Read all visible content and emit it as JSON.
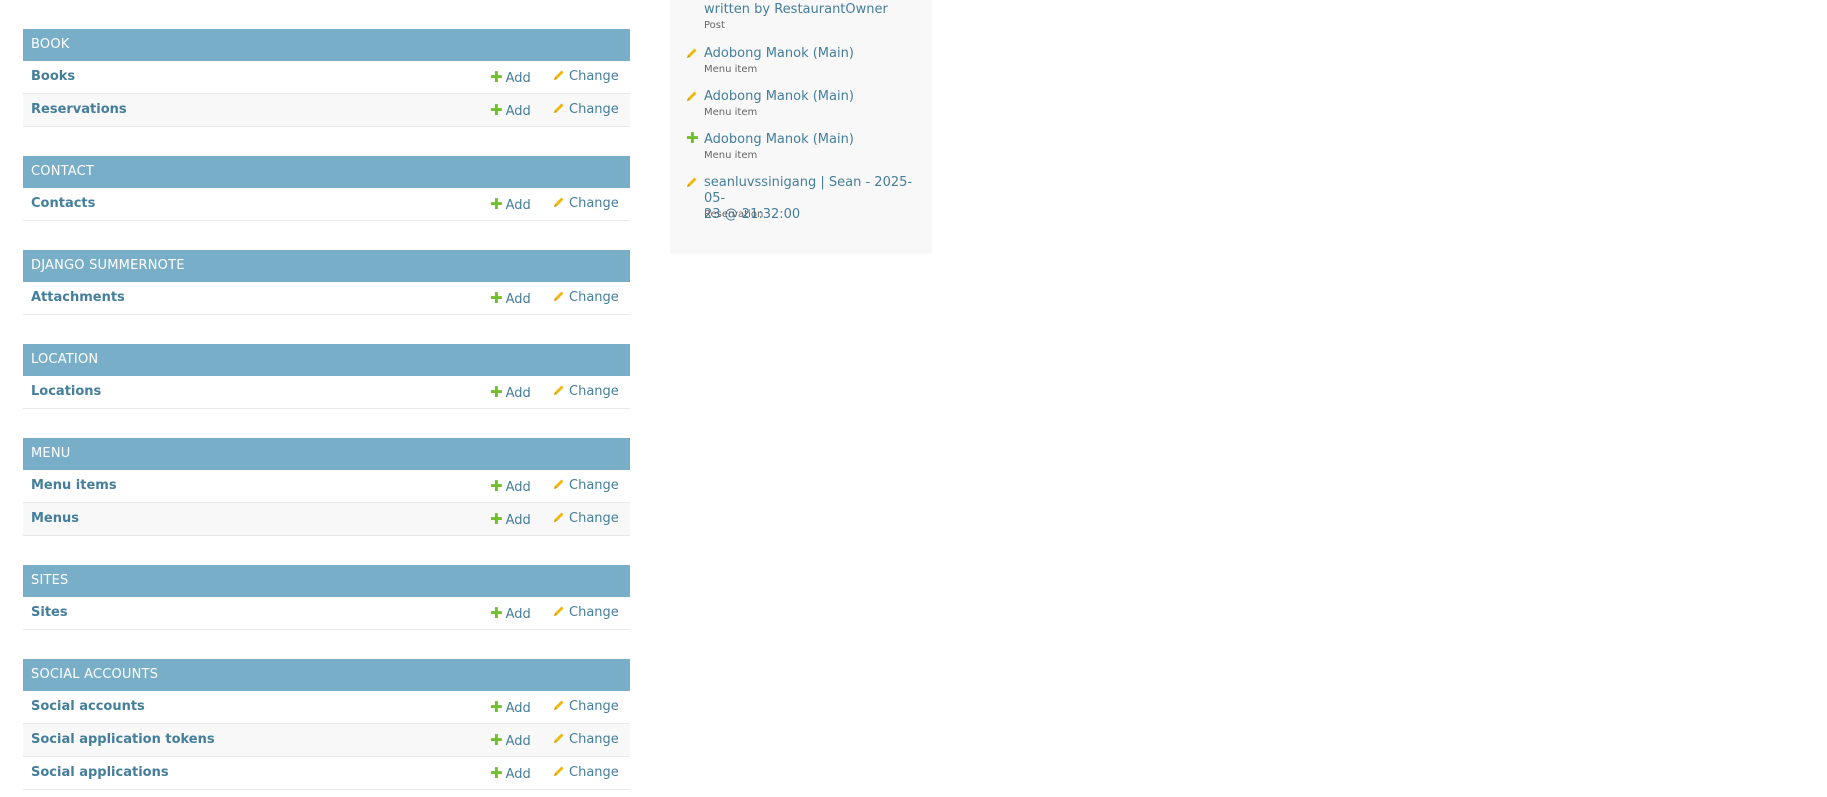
{
  "modules": [
    {
      "caption": "Book",
      "rows": [
        {
          "model": "Books",
          "add": "Add",
          "change": "Change"
        },
        {
          "model": "Reservations",
          "add": "Add",
          "change": "Change"
        }
      ]
    },
    {
      "caption": "Contact",
      "rows": [
        {
          "model": "Contacts",
          "add": "Add",
          "change": "Change"
        }
      ]
    },
    {
      "caption": "Django Summernote",
      "rows": [
        {
          "model": "Attachments",
          "add": "Add",
          "change": "Change"
        }
      ]
    },
    {
      "caption": "Location",
      "rows": [
        {
          "model": "Locations",
          "add": "Add",
          "change": "Change"
        }
      ]
    },
    {
      "caption": "Menu",
      "rows": [
        {
          "model": "Menu items",
          "add": "Add",
          "change": "Change"
        },
        {
          "model": "Menus",
          "add": "Add",
          "change": "Change"
        }
      ]
    },
    {
      "caption": "Sites",
      "rows": [
        {
          "model": "Sites",
          "add": "Add",
          "change": "Change"
        }
      ]
    },
    {
      "caption": "Social Accounts",
      "rows": [
        {
          "model": "Social accounts",
          "add": "Add",
          "change": "Change"
        },
        {
          "model": "Social application tokens",
          "add": "Add",
          "change": "Change"
        },
        {
          "model": "Social applications",
          "add": "Add",
          "change": "Change"
        }
      ]
    }
  ],
  "recent_actions": [
    {
      "icon": "pencil-icon",
      "line1": "written by RestaurantOwner",
      "line2": "",
      "type": "Post"
    },
    {
      "icon": "pencil-icon",
      "line1": "Adobong Manok (Main)",
      "line2": "",
      "type": "Menu item"
    },
    {
      "icon": "pencil-icon",
      "line1": "Adobong Manok (Main)",
      "line2": "",
      "type": "Menu item"
    },
    {
      "icon": "plus-icon",
      "line1": "Adobong Manok (Main)",
      "line2": "",
      "type": "Menu item"
    },
    {
      "icon": "pencil-icon",
      "line1": "seanluvssinigang | Sean - 2025-05-",
      "line2": "23 @ 21:32:00",
      "type": "Reservation"
    }
  ],
  "colors": {
    "caption_bg": "#79aec8",
    "link": "#447e9b",
    "add_icon": "#70bf2b",
    "change_icon": "#efb80b",
    "sidebar_bg": "#f8f8f8"
  }
}
